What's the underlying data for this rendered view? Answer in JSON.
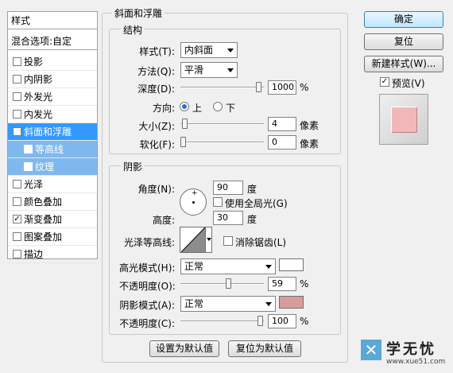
{
  "left_panel": {
    "header": "样式",
    "blend_options": "混合选项:自定",
    "items": [
      {
        "label": "投影",
        "checked": false
      },
      {
        "label": "内阴影",
        "checked": false
      },
      {
        "label": "外发光",
        "checked": false
      },
      {
        "label": "内发光",
        "checked": false
      },
      {
        "label": "斜面和浮雕",
        "checked": true,
        "selected": true
      },
      {
        "label": "等高线",
        "checked": false,
        "sub": true
      },
      {
        "label": "纹理",
        "checked": false,
        "sub": true
      },
      {
        "label": "光泽",
        "checked": false
      },
      {
        "label": "颜色叠加",
        "checked": false
      },
      {
        "label": "渐变叠加",
        "checked": true
      },
      {
        "label": "图案叠加",
        "checked": false
      },
      {
        "label": "描边",
        "checked": false
      }
    ]
  },
  "bevel": {
    "title": "斜面和浮雕",
    "structure": {
      "title": "结构",
      "style_label": "样式(T):",
      "style_value": "内斜面",
      "technique_label": "方法(Q):",
      "technique_value": "平滑",
      "depth_label": "深度(D):",
      "depth_value": "1000",
      "depth_unit": "%",
      "depth_fraction": 0.98,
      "direction_label": "方向:",
      "direction_up": "上",
      "direction_down": "下",
      "size_label": "大小(Z):",
      "size_value": "4",
      "size_unit": "像素",
      "size_fraction": 0.02,
      "soften_label": "软化(F):",
      "soften_value": "0",
      "soften_unit": "像素",
      "soften_fraction": 0.0
    },
    "shading": {
      "title": "阴影",
      "angle_label": "角度(N):",
      "angle_value": "90",
      "angle_unit": "度",
      "global_light_label": "使用全局光(G)",
      "altitude_label": "高度:",
      "altitude_value": "30",
      "altitude_unit": "度",
      "gloss_label": "光泽等高线:",
      "antialias_label": "消除锯齿(L)",
      "highlight_label": "高光模式(H):",
      "highlight_value": "正常",
      "highlight_color": "#ffffff",
      "highlight_opacity_label": "不透明度(O):",
      "highlight_opacity_value": "59",
      "highlight_opacity_unit": "%",
      "highlight_opacity_fraction": 0.59,
      "shadow_label": "阴影模式(A):",
      "shadow_value": "正常",
      "shadow_color": "#d99c9c",
      "shadow_opacity_label": "不透明度(C):",
      "shadow_opacity_value": "100",
      "shadow_opacity_unit": "%",
      "shadow_opacity_fraction": 1.0
    },
    "set_default": "设置为默认值",
    "reset_default": "复位为默认值"
  },
  "right_panel": {
    "ok": "确定",
    "reset": "复位",
    "new_style": "新建样式(W)...",
    "preview_label": "预览(V)",
    "preview_checked": true,
    "preview_color": "#f0b8b8"
  },
  "watermark": {
    "text": "学无忧",
    "url": "www.xue51.com"
  }
}
